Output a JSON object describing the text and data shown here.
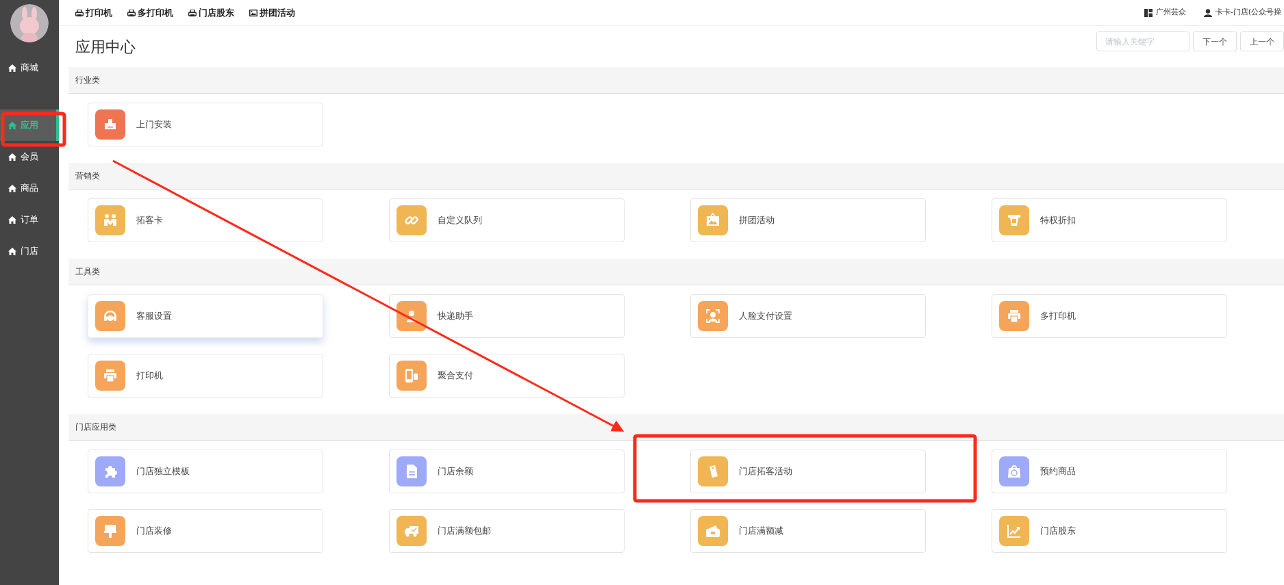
{
  "sidebar": {
    "items": [
      {
        "label": "商城",
        "selected": false
      },
      {
        "label": "应用",
        "selected": true
      },
      {
        "label": "会员",
        "selected": false
      },
      {
        "label": "商品",
        "selected": false
      },
      {
        "label": "订单",
        "selected": false
      },
      {
        "label": "门店",
        "selected": false
      }
    ]
  },
  "top_links": [
    {
      "label": "打印机",
      "kind": "printer"
    },
    {
      "label": "多打印机",
      "kind": "printer"
    },
    {
      "label": "门店股东",
      "kind": "printer"
    },
    {
      "label": "拼团活动",
      "kind": "image"
    }
  ],
  "account": {
    "shop": "广州芸众",
    "user": "卡卡-门店(公众号操"
  },
  "page_title": "应用中心",
  "search": {
    "placeholder": "请输入关键字"
  },
  "buttons": [
    "下一个",
    "上一个"
  ],
  "sections": [
    {
      "title": "行业类",
      "apps": [
        {
          "label": "上门安装",
          "color": "#ef7452",
          "hovered": false
        }
      ]
    },
    {
      "title": "营销类",
      "apps": [
        {
          "label": "拓客卡",
          "color": "#f0b654",
          "hovered": false
        },
        {
          "label": "自定义队列",
          "color": "#f0b654",
          "hovered": false
        },
        {
          "label": "拼团活动",
          "color": "#f0b654",
          "hovered": false
        },
        {
          "label": "特权折扣",
          "color": "#f0b654",
          "hovered": false
        }
      ]
    },
    {
      "title": "工具类",
      "apps": [
        {
          "label": "客服设置",
          "color": "#f5a55a",
          "hovered": true
        },
        {
          "label": "快递助手",
          "color": "#f5a55a",
          "hovered": false
        },
        {
          "label": "人脸支付设置",
          "color": "#f5a55a",
          "hovered": false
        },
        {
          "label": "多打印机",
          "color": "#f5a55a",
          "hovered": false
        },
        {
          "label": "打印机",
          "color": "#f5a55a",
          "hovered": false
        },
        {
          "label": "聚合支付",
          "color": "#f5a55a",
          "hovered": false
        }
      ]
    },
    {
      "title": "门店应用类",
      "apps": [
        {
          "label": "门店独立模板",
          "color": "#9eaaf8",
          "hovered": false
        },
        {
          "label": "门店余额",
          "color": "#9eaaf8",
          "hovered": false
        },
        {
          "label": "门店拓客活动",
          "color": "#f0b654",
          "hovered": false
        },
        {
          "label": "预约商品",
          "color": "#9eaaf8",
          "hovered": false
        },
        {
          "label": "门店装修",
          "color": "#f5a55a",
          "hovered": false
        },
        {
          "label": "门店满额包邮",
          "color": "#f0b654",
          "hovered": false
        },
        {
          "label": "门店满额减",
          "color": "#f0b654",
          "hovered": false
        },
        {
          "label": "门店股东",
          "color": "#f0b654",
          "hovered": false
        }
      ]
    }
  ]
}
